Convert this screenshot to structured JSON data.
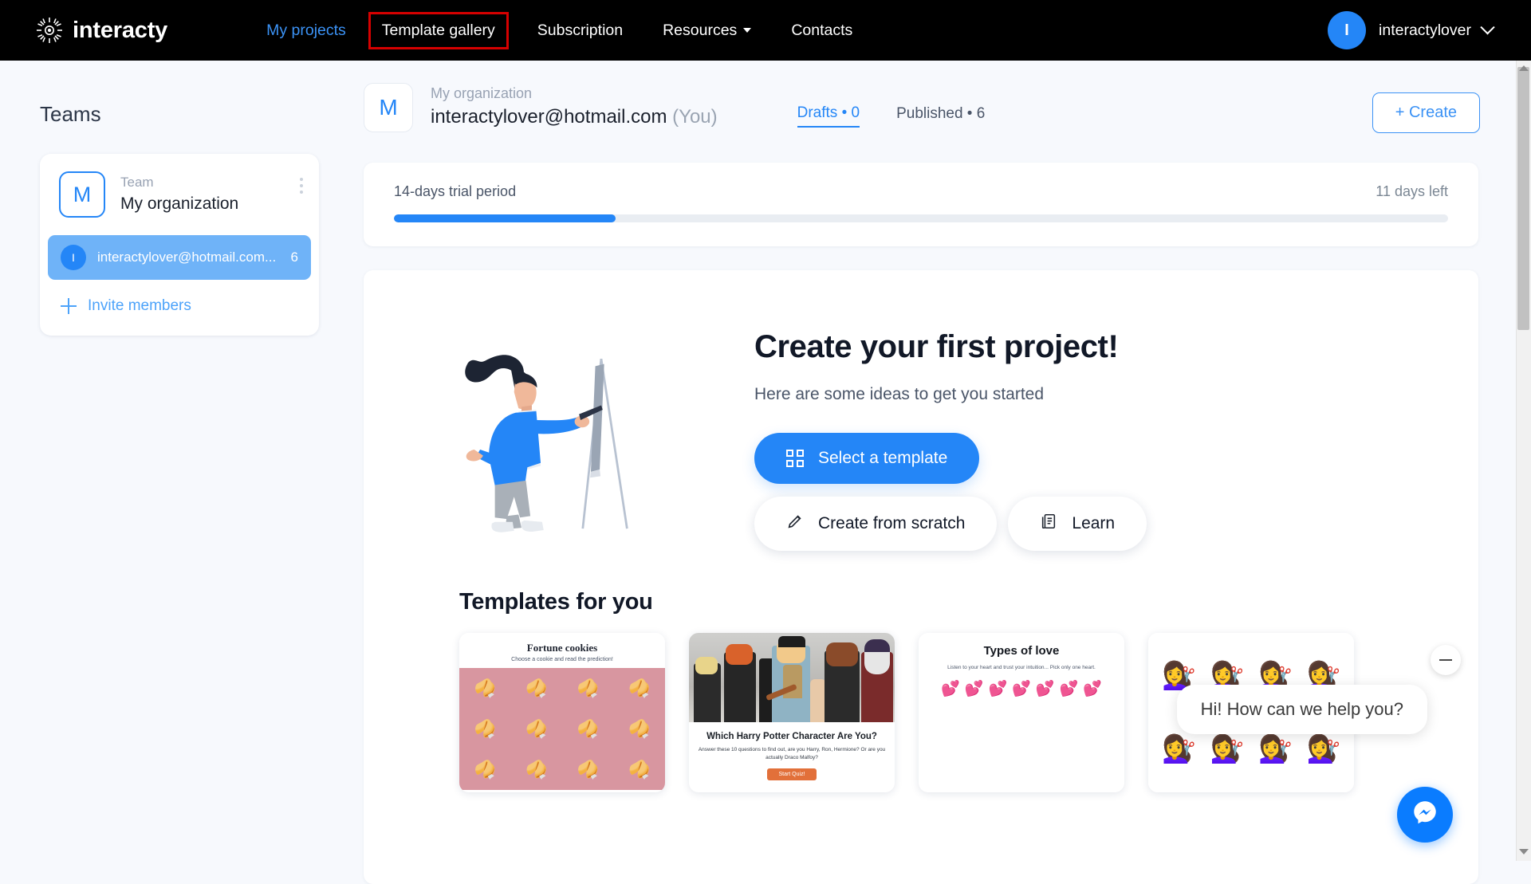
{
  "brand": {
    "name": "interacty",
    "logo_icon": "sun-burst-icon"
  },
  "topnav": {
    "items": [
      {
        "label": "My projects",
        "state": "link-blue"
      },
      {
        "label": "Template gallery",
        "state": "highlighted"
      },
      {
        "label": "Subscription",
        "state": "normal"
      },
      {
        "label": "Resources",
        "state": "dropdown"
      },
      {
        "label": "Contacts",
        "state": "normal"
      }
    ],
    "user": {
      "initial": "I",
      "name": "interactylover",
      "chevron_icon": "chevron-down-icon"
    },
    "highlight_color": "#d60000"
  },
  "sidebar": {
    "title": "Teams",
    "team": {
      "logo_initial": "M",
      "label": "Team",
      "name": "My organization",
      "menu_icon": "kebab-menu-icon"
    },
    "member": {
      "initial": "I",
      "email": "interactylover@hotmail.com...",
      "count": "6"
    },
    "invite": {
      "label": "Invite members",
      "icon": "plus-icon"
    }
  },
  "main": {
    "org": {
      "logo_initial": "M",
      "subtitle": "My organization",
      "email": "interactylover@hotmail.com",
      "you": "(You)"
    },
    "tabs": [
      {
        "label": "Drafts • 0",
        "active": true
      },
      {
        "label": "Published • 6",
        "active": false
      }
    ],
    "create_button": "+ Create",
    "trial": {
      "label": "14-days trial period",
      "days_left": "11 days left",
      "progress_percent": 21,
      "fill_color": "#2486f7"
    },
    "hero": {
      "title": "Create your first project!",
      "subtitle": "Here are some ideas to get you started",
      "buttons": [
        {
          "label": "Select a template",
          "icon": "grid-icon",
          "style": "primary"
        },
        {
          "label": "Create from scratch",
          "icon": "pencil-icon",
          "style": "white"
        },
        {
          "label": "Learn",
          "icon": "book-icon",
          "style": "white"
        }
      ],
      "illustration": "woman-painting-easel-illustration"
    },
    "templates": {
      "heading": "Templates for you",
      "cards": [
        {
          "name": "fortune-cookies",
          "title": "Fortune cookies",
          "subtitle": "Choose a cookie and read the prediction!",
          "bg": "#d896a0",
          "emoji": "🥠",
          "emoji_count": 12
        },
        {
          "name": "harry-potter-quiz",
          "title": "Which Harry Potter Character Are You?",
          "subtitle": "Answer these 10 questions to find out, are you Harry, Ron, Hermione? Or are you actually Draco Malfoy?",
          "cta": "Start Quiz!",
          "cta_color": "#e2703a"
        },
        {
          "name": "types-of-love",
          "title": "Types of love",
          "subtitle": "Listen to your heart and trust your intuition... Pick only one heart.",
          "emoji": "💕",
          "emoji_count": 7
        },
        {
          "name": "lady-portraits",
          "emoji": "💇‍♀️",
          "emoji_count": 8
        }
      ]
    }
  },
  "chat": {
    "message": "Hi! How can we help you?",
    "minimize_icon": "minimize-icon",
    "messenger_icon": "messenger-icon",
    "messenger_color": "#0a7cff"
  },
  "scrollbar": {
    "up_icon": "scroll-up-arrow-icon",
    "down_icon": "scroll-down-arrow-icon"
  }
}
